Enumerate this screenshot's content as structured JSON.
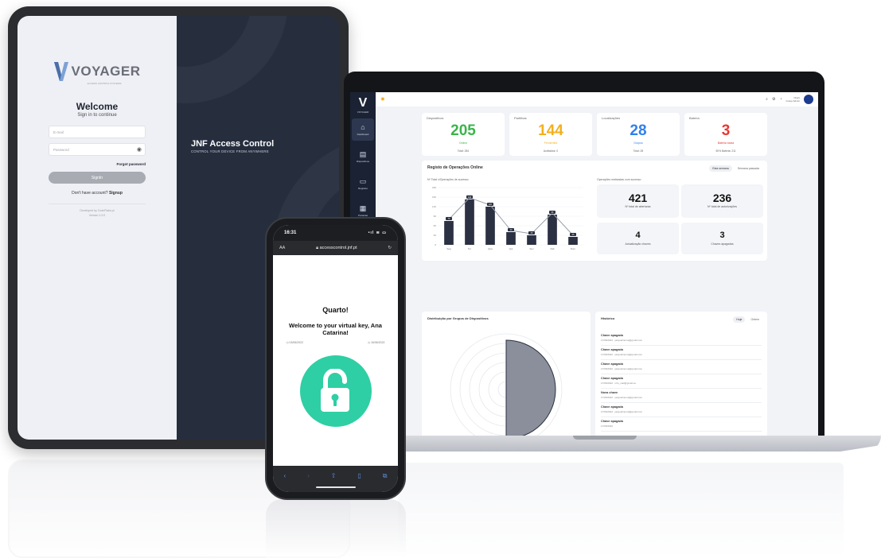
{
  "tablet": {
    "logo_text": "VOYAGER",
    "logo_sub": "ACCESS CONTROL SYSTEMS",
    "welcome": "Welcome",
    "signin_sub": "Sign in to continue",
    "email_placeholder": "E-mail",
    "password_placeholder": "Password",
    "forgot": "Forgot password",
    "signin_button": "SignIn",
    "no_account": "Don't have account?",
    "signup": "Signup",
    "dev_line1": "Developed by CodeFlake.pt",
    "dev_line2": "Version 1.0.0",
    "promo_title": "JNF Access Control",
    "promo_sub": "CONTROL YOUR DEVICE FROM ANYWHERE"
  },
  "laptop": {
    "sidebar": {
      "logo": "V",
      "logo_text": "VOYAGER",
      "items": [
        {
          "label": "Dashboard",
          "icon": "home-icon"
        },
        {
          "label": "Dispositivos",
          "icon": "device-icon"
        },
        {
          "label": "Registos",
          "icon": "register-icon"
        },
        {
          "label": "Portarias",
          "icon": "building-icon"
        }
      ]
    },
    "topbar": {
      "user_name": "Client",
      "user_sub": "Group Admin"
    },
    "stats": [
      {
        "title": "Dispositivos",
        "value": "205",
        "sub": "Online",
        "foot": "Total: 284",
        "color": "#3bb54a"
      },
      {
        "title": "Partilhas",
        "value": "144",
        "sub": "Pendentes",
        "foot": "Aceitados: 0",
        "color": "#f2b01e"
      },
      {
        "title": "Localizações",
        "value": "28",
        "sub": "Grupos",
        "foot": "Total: 28",
        "color": "#2f80ed"
      },
      {
        "title": "Bateria",
        "value": "3",
        "sub": "Bateria baixa",
        "foot": "50% Bateria: 211",
        "color": "#e53935"
      }
    ],
    "ops": {
      "title": "Registo de Operações Online",
      "tab_active": "Esta semana",
      "tab_other": "Semana passada",
      "chart_label": "Nº Total c/Operações de sucesso",
      "right_label": "Operações realizadas com sucesso",
      "mini": [
        {
          "value": "421",
          "label": "Nº total de aberturas"
        },
        {
          "value": "236",
          "label": "Nº total de autorizações"
        },
        {
          "value": "4",
          "label": "Actualização chaves"
        },
        {
          "value": "3",
          "label": "Chaves apagadas"
        }
      ]
    },
    "dist": {
      "title": "Distribuição por Grupos de Dispositivos"
    },
    "hist": {
      "title": "Histórico",
      "tab_active": "Hoje",
      "tab_other": "Ontem",
      "items": [
        {
          "name": "Chave apagada",
          "meta": "17/06/2022   ·   jacquelinema@gmail.com"
        },
        {
          "name": "Chave apagada",
          "meta": "17/06/2022   ·   jacquelinema@gmail.com"
        },
        {
          "name": "Chave apagada",
          "meta": "17/06/2022   ·   jacquelinema@gmail.com"
        },
        {
          "name": "Chave apagada",
          "meta": "17/06/2022   ·   info_mail@gmail.es"
        },
        {
          "name": "Nova chave",
          "meta": "17/06/2022   ·   jacquelinema@gmail.com"
        },
        {
          "name": "Chave apagada",
          "meta": "17/06/2022   ·   jacquelinema@gmail.com"
        },
        {
          "name": "Chave apagada",
          "meta": "17/06/2022"
        }
      ]
    }
  },
  "chart_data": {
    "type": "bar",
    "categories": [
      "Seg",
      "Ter",
      "Qua",
      "Qui",
      "Sex",
      "Sab",
      "Dom"
    ],
    "values": [
      75,
      143,
      120,
      40,
      30,
      95,
      25
    ],
    "ylim": [
      0,
      180
    ],
    "yticks": [
      "0",
      "30",
      "60",
      "90",
      "120",
      "150",
      "180"
    ],
    "bar_color": "#2b3142",
    "line_color": "#9aa0ab"
  },
  "phone": {
    "time": "16:31",
    "status_icons": "•ıl ≋ ▭",
    "aa": "AA",
    "url": "accesscontrol.jnf.pt",
    "room": "Quarto!",
    "welcome": "Welcome to your virtual key, Ana Catarina!",
    "date_from": "03/06/2022",
    "date_to": "16/06/2022",
    "accent": "#2ecfa4"
  }
}
